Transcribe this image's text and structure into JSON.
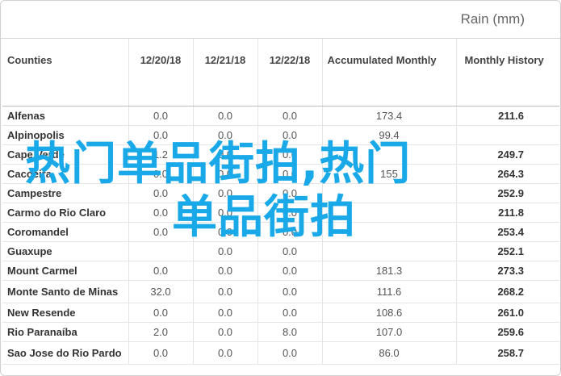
{
  "header": {
    "title": "Rain (mm)"
  },
  "table": {
    "columns": [
      "Counties",
      "12/20/18",
      "12/21/18",
      "12/22/18",
      "Accumulated Monthly",
      "Monthly History"
    ],
    "rows": [
      {
        "county": "Alfenas",
        "d1": "0.0",
        "d2": "0.0",
        "d3": "0.0",
        "acc": "173.4",
        "hist": "211.6"
      },
      {
        "county": "Alpinopolis",
        "d1": "0.0",
        "d2": "0.0",
        "d3": "0.0",
        "acc": "99.4",
        "hist": ""
      },
      {
        "county": "Cape Verde",
        "d1": "1.2",
        "d2": "0.0",
        "d3": "0.0",
        "acc": "",
        "hist": "249.7"
      },
      {
        "county": "Cacoeira",
        "d1": "0.0",
        "d2": "0.0",
        "d3": "0.0",
        "acc": "155",
        "hist": "264.3"
      },
      {
        "county": "Campestre",
        "d1": "0.0",
        "d2": "0.0",
        "d3": "0.0",
        "acc": "",
        "hist": "252.9"
      },
      {
        "county": "Carmo do Rio Claro",
        "d1": "0.0",
        "d2": "0.0",
        "d3": "0.0",
        "acc": "",
        "hist": "211.8"
      },
      {
        "county": "Coromandel",
        "d1": "0.0",
        "d2": "0.0",
        "d3": "0.0",
        "acc": "",
        "hist": "253.4"
      },
      {
        "county": "Guaxupe",
        "d1": "",
        "d2": "0.0",
        "d3": "0.0",
        "acc": "",
        "hist": "252.1"
      },
      {
        "county": "Mount Carmel",
        "d1": "0.0",
        "d2": "0.0",
        "d3": "0.0",
        "acc": "181.3",
        "hist": "273.3"
      },
      {
        "county": "Monte Santo de Minas",
        "d1": "32.0",
        "d2": "0.0",
        "d3": "0.0",
        "acc": "111.6",
        "hist": "268.2"
      },
      {
        "county": "New Resende",
        "d1": "0.0",
        "d2": "0.0",
        "d3": "0.0",
        "acc": "108.6",
        "hist": "261.0"
      },
      {
        "county": "Rio Paranaíba",
        "d1": "2.0",
        "d2": "0.0",
        "d3": "8.0",
        "acc": "107.0",
        "hist": "259.6"
      },
      {
        "county": "Sao Jose do Rio Pardo",
        "d1": "0.0",
        "d2": "0.0",
        "d3": "0.0",
        "acc": "86.0",
        "hist": "258.7"
      }
    ]
  },
  "overlay": {
    "line1": "热门单品街拍,热门",
    "line2": "单品街拍"
  },
  "colors": {
    "overlay_text": "#1aa9e8",
    "border": "#d6d6d6"
  }
}
